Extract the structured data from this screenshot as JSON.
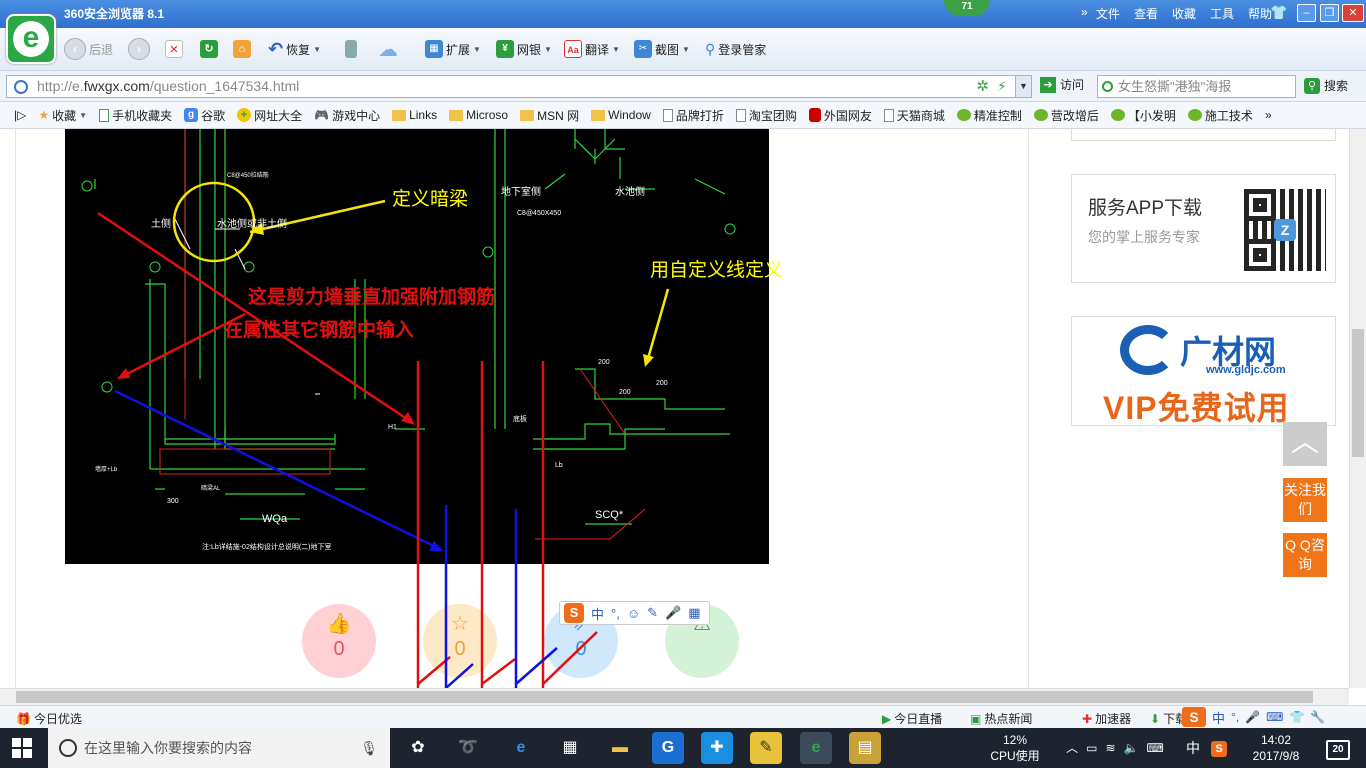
{
  "browser": {
    "title": "360安全浏览器 8.1",
    "badge": "71",
    "menu": [
      "文件",
      "查看",
      "收藏",
      "工具",
      "帮助"
    ],
    "nav": {
      "back": "后退",
      "restore": "恢复"
    },
    "tools": [
      {
        "label": "扩展",
        "icon": "grid-icon"
      },
      {
        "label": "网银",
        "icon": "shield-icon"
      },
      {
        "label": "翻译",
        "icon": "translate-icon"
      },
      {
        "label": "截图",
        "icon": "scissors-icon"
      },
      {
        "label": "登录管家",
        "icon": "key-icon"
      }
    ],
    "url_prefix": "http://e.",
    "url_domain": "fwxgx.com",
    "url_path": "/question_1647534.html",
    "visit": "访问",
    "search_text": "女生怒撕\"港独\"海报",
    "search_btn": "搜索",
    "bookmarks": [
      "收藏",
      "手机收藏夹",
      "谷歌",
      "网址大全",
      "游戏中心",
      "Links",
      "Microso",
      "MSN 网",
      "Window",
      "品牌打折",
      "淘宝团购",
      "外国网友",
      "天猫商城",
      "精准控制",
      "营改增后",
      "【小发明",
      "施工技术"
    ]
  },
  "annotations": {
    "define_beam": "定义暗梁",
    "custom_line": "用自定义线定义",
    "shear_wall_1": "这是剪力墙垂直加强附加钢筋",
    "shear_wall_2": "在属性其它钢筋中输入"
  },
  "cad_labels": {
    "left_side": "土侧",
    "pool_side": "水池侧或非土侧",
    "basement_side": "地下室侧",
    "pool_side2": "水池侧",
    "spec1": "C8@450拉结筋",
    "spec2": "C8@450X450",
    "wqa": "WQa",
    "scq": "SCQ*",
    "note": "注:Lb详结施-02结构设计总说明(二)地下室",
    "dim300": "300",
    "dim200a": "200",
    "dim200b": "200",
    "dim200c": "200",
    "beam": "暗梁AL",
    "bottom_slab": "底板",
    "h1": "H1",
    "lb": "Lb",
    "wall_lb": "墙厚+Lb"
  },
  "actions": [
    {
      "name": "like",
      "icon": "thumbs-up-icon",
      "count": "0",
      "color": "#ffd1d4",
      "fg": "#e25563"
    },
    {
      "name": "favorite",
      "icon": "star-icon",
      "count": "0",
      "color": "#fde9c8",
      "fg": "#e8a534"
    },
    {
      "name": "share",
      "icon": "share-icon",
      "count": "0",
      "color": "#cfe8fb",
      "fg": "#3b94db"
    },
    {
      "name": "report",
      "icon": "warning-icon",
      "count": "",
      "color": "#d3f2d8",
      "fg": "#3aa04a"
    }
  ],
  "ime_bar": [
    "中",
    "°,",
    "☺",
    "✎",
    "🎤",
    "▦"
  ],
  "sidebar": {
    "app_title": "服务APP下载",
    "app_sub": "您的掌上服务专家",
    "ad_brand": "广材网",
    "ad_url": "www.gldjc.com",
    "ad_vip": "VIP免费试用",
    "follow": "关注我们",
    "qq": "Q Q咨询"
  },
  "status": {
    "left": "今日优选",
    "items": [
      "今日直播",
      "热点新闻",
      "加速器",
      "下载"
    ]
  },
  "taskbar": {
    "search_placeholder": "在这里输入你要搜索的内容",
    "cpu_pct": "12%",
    "cpu_label": "CPU使用",
    "ime": "中",
    "time": "14:02",
    "date": "2017/9/8",
    "notifications": "20"
  }
}
